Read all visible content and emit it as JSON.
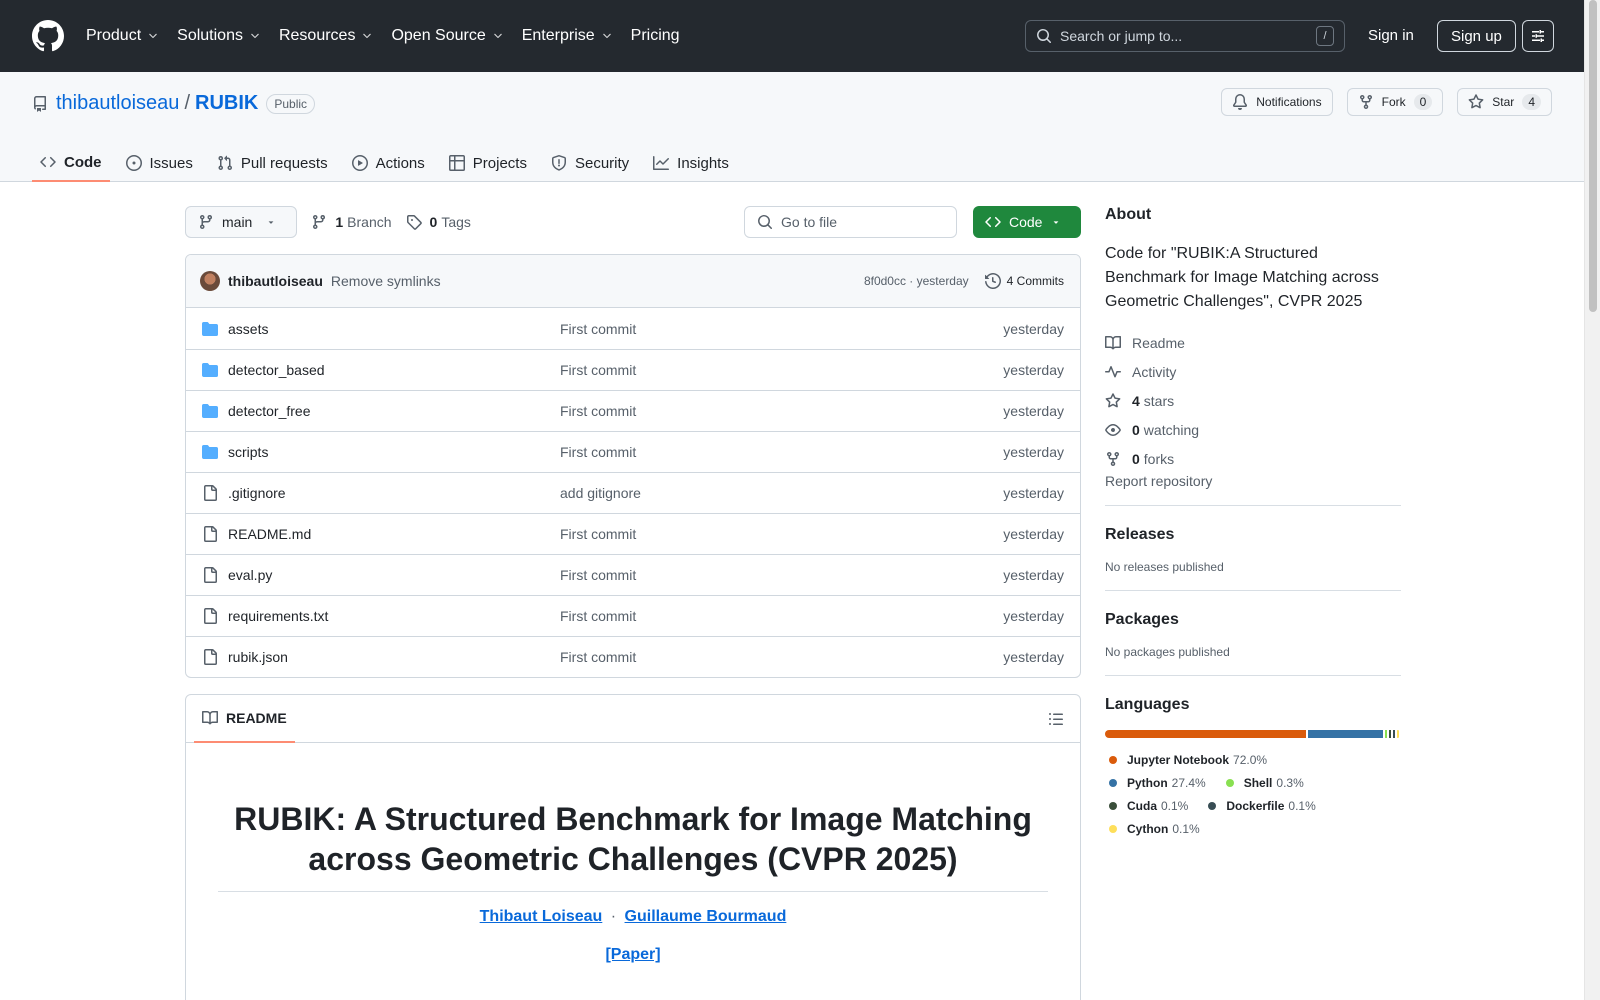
{
  "header": {
    "nav": [
      "Product",
      "Solutions",
      "Resources",
      "Open Source",
      "Enterprise",
      "Pricing"
    ],
    "search_placeholder": "Search or jump to...",
    "search_shortcut": "/",
    "signin": "Sign in",
    "signup": "Sign up"
  },
  "repo": {
    "owner": "thibautloiseau",
    "separator": "/",
    "name": "RUBIK",
    "visibility": "Public",
    "notifications": "Notifications",
    "fork_label": "Fork",
    "fork_count": "0",
    "star_label": "Star",
    "star_count": "4"
  },
  "tabs": [
    {
      "label": "Code",
      "active": true,
      "icon": "code-icon"
    },
    {
      "label": "Issues",
      "icon": "issue-icon"
    },
    {
      "label": "Pull requests",
      "icon": "pull-request-icon"
    },
    {
      "label": "Actions",
      "icon": "play-icon"
    },
    {
      "label": "Projects",
      "icon": "table-icon"
    },
    {
      "label": "Security",
      "icon": "shield-icon"
    },
    {
      "label": "Insights",
      "icon": "graph-icon"
    }
  ],
  "toolbar": {
    "branch": "main",
    "branch_count": "1",
    "branch_label": "Branch",
    "tag_count": "0",
    "tag_label": "Tags",
    "goto_placeholder": "Go to file",
    "code_button": "Code"
  },
  "commit": {
    "author": "thibautloiseau",
    "message": "Remove symlinks",
    "sha_time": "8f0d0cc · yesterday",
    "count": "4 Commits"
  },
  "files": [
    {
      "name": "assets",
      "type": "dir",
      "message": "First commit",
      "date": "yesterday"
    },
    {
      "name": "detector_based",
      "type": "dir",
      "message": "First commit",
      "date": "yesterday"
    },
    {
      "name": "detector_free",
      "type": "dir",
      "message": "First commit",
      "date": "yesterday"
    },
    {
      "name": "scripts",
      "type": "dir",
      "message": "First commit",
      "date": "yesterday"
    },
    {
      "name": ".gitignore",
      "type": "file",
      "message": "add gitignore",
      "date": "yesterday"
    },
    {
      "name": "README.md",
      "type": "file",
      "message": "First commit",
      "date": "yesterday"
    },
    {
      "name": "eval.py",
      "type": "file",
      "message": "First commit",
      "date": "yesterday"
    },
    {
      "name": "requirements.txt",
      "type": "file",
      "message": "First commit",
      "date": "yesterday"
    },
    {
      "name": "rubik.json",
      "type": "file",
      "message": "First commit",
      "date": "yesterday"
    }
  ],
  "readme": {
    "tab": "README",
    "title": "RUBIK: A Structured Benchmark for Image Matching across Geometric Challenges (CVPR 2025)",
    "author1": "Thibaut Loiseau",
    "author_sep": "·",
    "author2": "Guillaume Bourmaud",
    "paper": "[Paper]"
  },
  "sidebar": {
    "about_title": "About",
    "description": "Code for \"RUBIK:A Structured Benchmark for Image Matching across Geometric Challenges\", CVPR 2025",
    "readme": "Readme",
    "activity": "Activity",
    "stars_count": "4",
    "stars_label": "stars",
    "watching_count": "0",
    "watching_label": "watching",
    "forks_count": "0",
    "forks_label": "forks",
    "report": "Report repository",
    "releases_title": "Releases",
    "releases_note": "No releases published",
    "packages_title": "Packages",
    "packages_note": "No packages published",
    "languages_title": "Languages",
    "languages": [
      {
        "name": "Jupyter Notebook",
        "pct": "72.0%",
        "value": 72.0,
        "color": "#DA5B0B"
      },
      {
        "name": "Python",
        "pct": "27.4%",
        "value": 27.4,
        "color": "#3572A5"
      },
      {
        "name": "Shell",
        "pct": "0.3%",
        "value": 0.3,
        "color": "#89e051"
      },
      {
        "name": "Cuda",
        "pct": "0.1%",
        "value": 0.1,
        "color": "#3A4E3A"
      },
      {
        "name": "Dockerfile",
        "pct": "0.1%",
        "value": 0.1,
        "color": "#384d54"
      },
      {
        "name": "Cython",
        "pct": "0.1%",
        "value": 0.1,
        "color": "#fedf5b"
      }
    ]
  },
  "colors": {
    "accent": "#0969da",
    "header_bg": "#24292f",
    "code_button": "#1f883d",
    "tab_underline": "#fd8c73"
  }
}
